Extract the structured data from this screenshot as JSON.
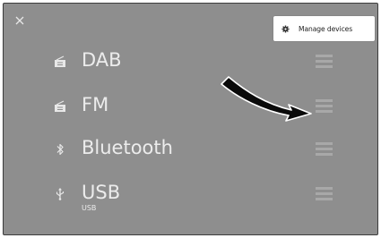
{
  "header": {
    "close_icon": "close-icon",
    "manage_devices_label": "Manage devices",
    "manage_devices_icon": "gear-icon"
  },
  "sources": [
    {
      "label": "DAB",
      "sub": "",
      "icon": "radio-icon"
    },
    {
      "label": "FM",
      "sub": "",
      "icon": "radio-icon"
    },
    {
      "label": "Bluetooth",
      "sub": "",
      "icon": "bluetooth-icon"
    },
    {
      "label": "USB",
      "sub": "USB",
      "icon": "usb-icon"
    }
  ],
  "colors": {
    "background": "#8e8e8e",
    "text": "#ececec",
    "handle": "#a8a8a8",
    "button_bg": "#ffffff"
  }
}
